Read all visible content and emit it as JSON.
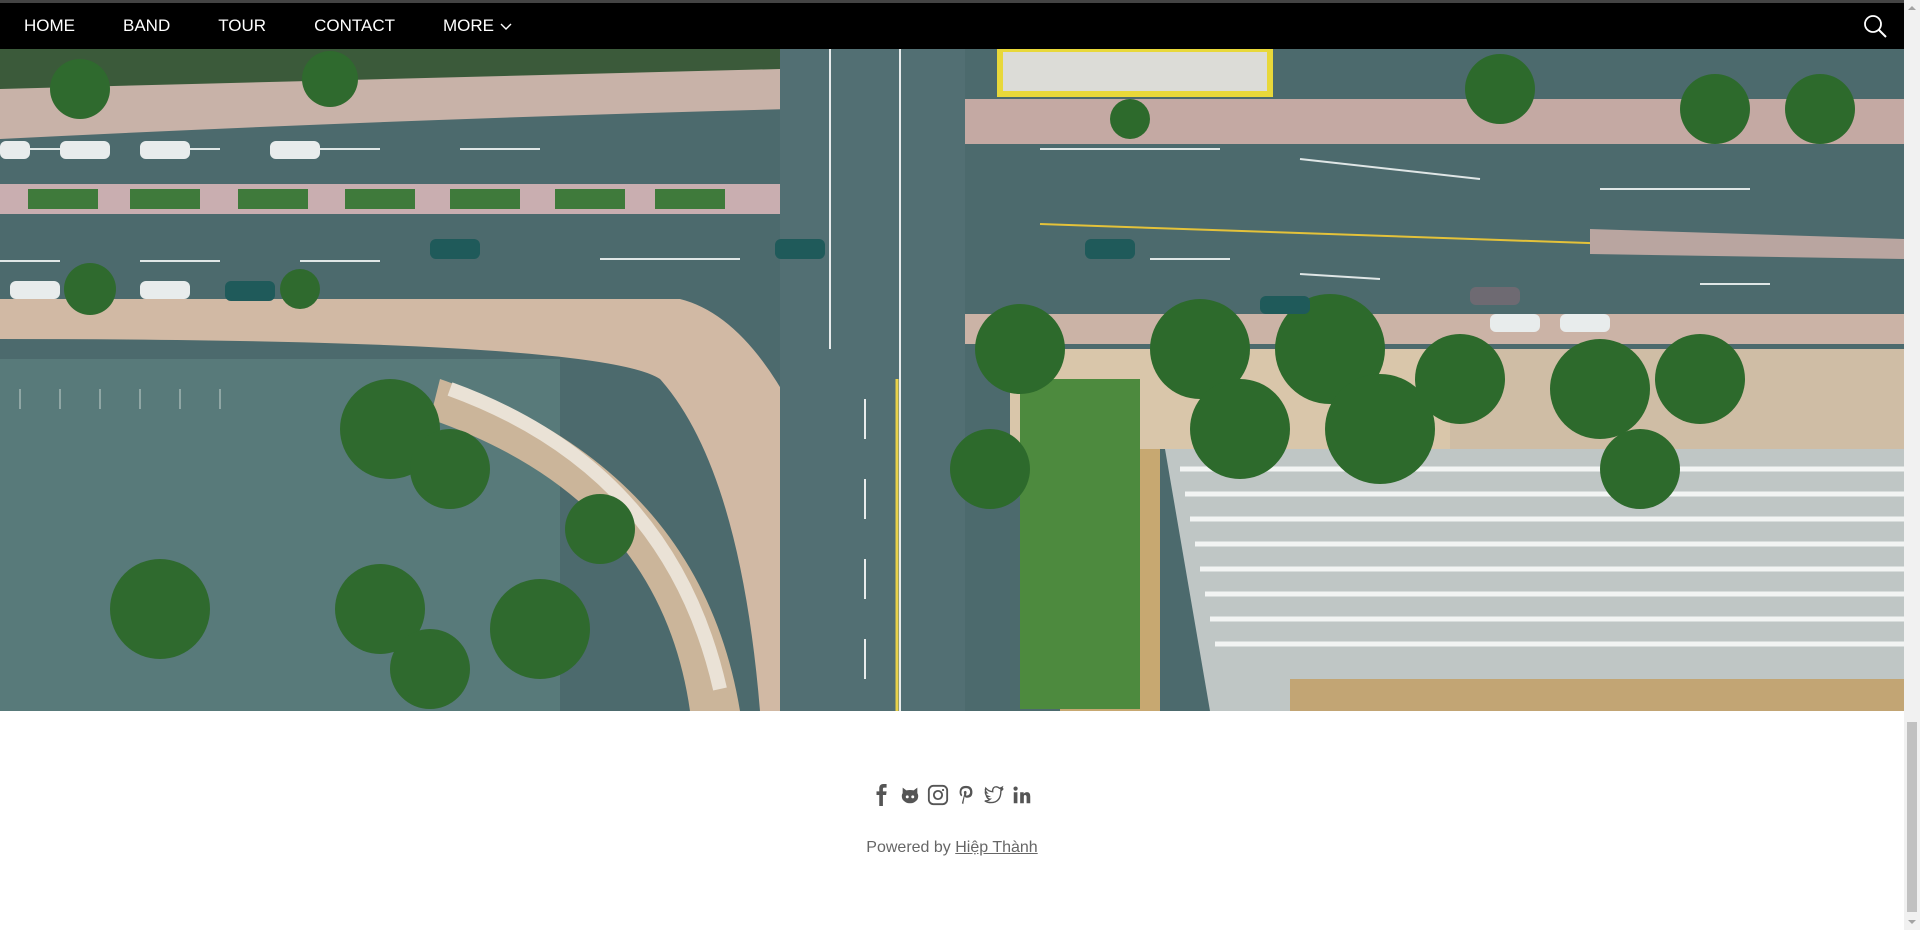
{
  "nav": {
    "items": [
      {
        "label": "HOME"
      },
      {
        "label": "BAND"
      },
      {
        "label": "TOUR"
      },
      {
        "label": "CONTACT"
      },
      {
        "label": "MORE"
      }
    ],
    "search_icon": "search-icon",
    "colors": {
      "background": "#000000",
      "text": "#ffffff"
    }
  },
  "hero": {
    "image": "aerial-city-intersection"
  },
  "footer": {
    "social_icons": [
      "facebook-icon",
      "github-icon",
      "instagram-icon",
      "pinterest-icon",
      "twitter-icon",
      "linkedin-icon"
    ],
    "powered_prefix": "Powered by",
    "author": "Hiệp Thành"
  }
}
